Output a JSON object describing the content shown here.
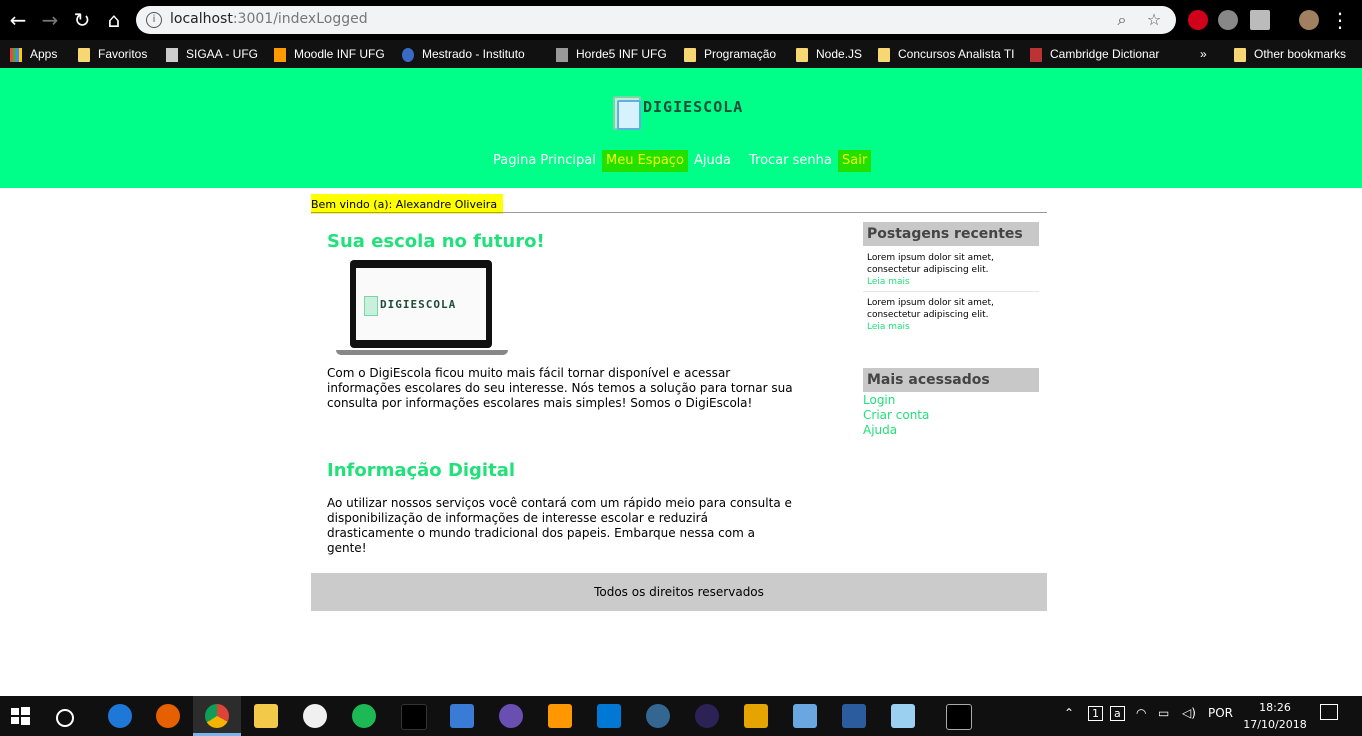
{
  "browser": {
    "url_host": "localhost",
    "url_path": ":3001/indexLogged",
    "bookmarks": [
      "Apps",
      "Favoritos",
      "SIGAA - UFG",
      "Moodle INF UFG",
      "Mestrado - Instituto",
      "Horde5 INF UFG",
      "Programação",
      "Node.JS",
      "Concursos Analista TI",
      "Cambridge Dictionar"
    ],
    "more_bookmarks": "»",
    "other_bookmarks": "Other bookmarks"
  },
  "site": {
    "logo_text": "DIGIESCOLA",
    "menu": [
      "Pagina Principal",
      "Meu Espaço",
      "Ajuda",
      "Trocar senha",
      "Sair"
    ],
    "highlight_color": "#22e100",
    "accent_color": "#00ff88"
  },
  "welcome": "Bem vindo (a): Alexandre Oliveira",
  "main": {
    "section1_title": "Sua escola no futuro!",
    "laptop_logo": "DIGIESCOLA",
    "section1_text": "Com o DigiEscola ficou muito mais fácil tornar disponível e acessar informações escolares do seu interesse. Nós temos a solução para tornar sua consulta por informações escolares mais simples! Somos o DigiEscola!",
    "section2_title": "Informação Digital",
    "section2_text": "Ao utilizar nossos serviços você contará com um rápido meio para consulta e disponibilização de informações de interesse escolar e reduzirá drasticamente o mundo tradicional dos papeis. Embarque nessa com a gente!"
  },
  "sidebar": {
    "recent_title": "Postagens recentes",
    "posts": [
      {
        "text": "Lorem ipsum dolor sit amet, consectetur adipiscing elit.",
        "more": "Leia mais"
      },
      {
        "text": "Lorem ipsum dolor sit amet, consectetur adipiscing elit.",
        "more": "Leia mais"
      }
    ],
    "most_title": "Mais acessados",
    "links": [
      "Login",
      "Criar conta",
      "Ajuda"
    ]
  },
  "footer": "Todos os direitos reservados",
  "taskbar": {
    "lang": "POR",
    "time": "18:26",
    "date": "17/10/2018"
  }
}
